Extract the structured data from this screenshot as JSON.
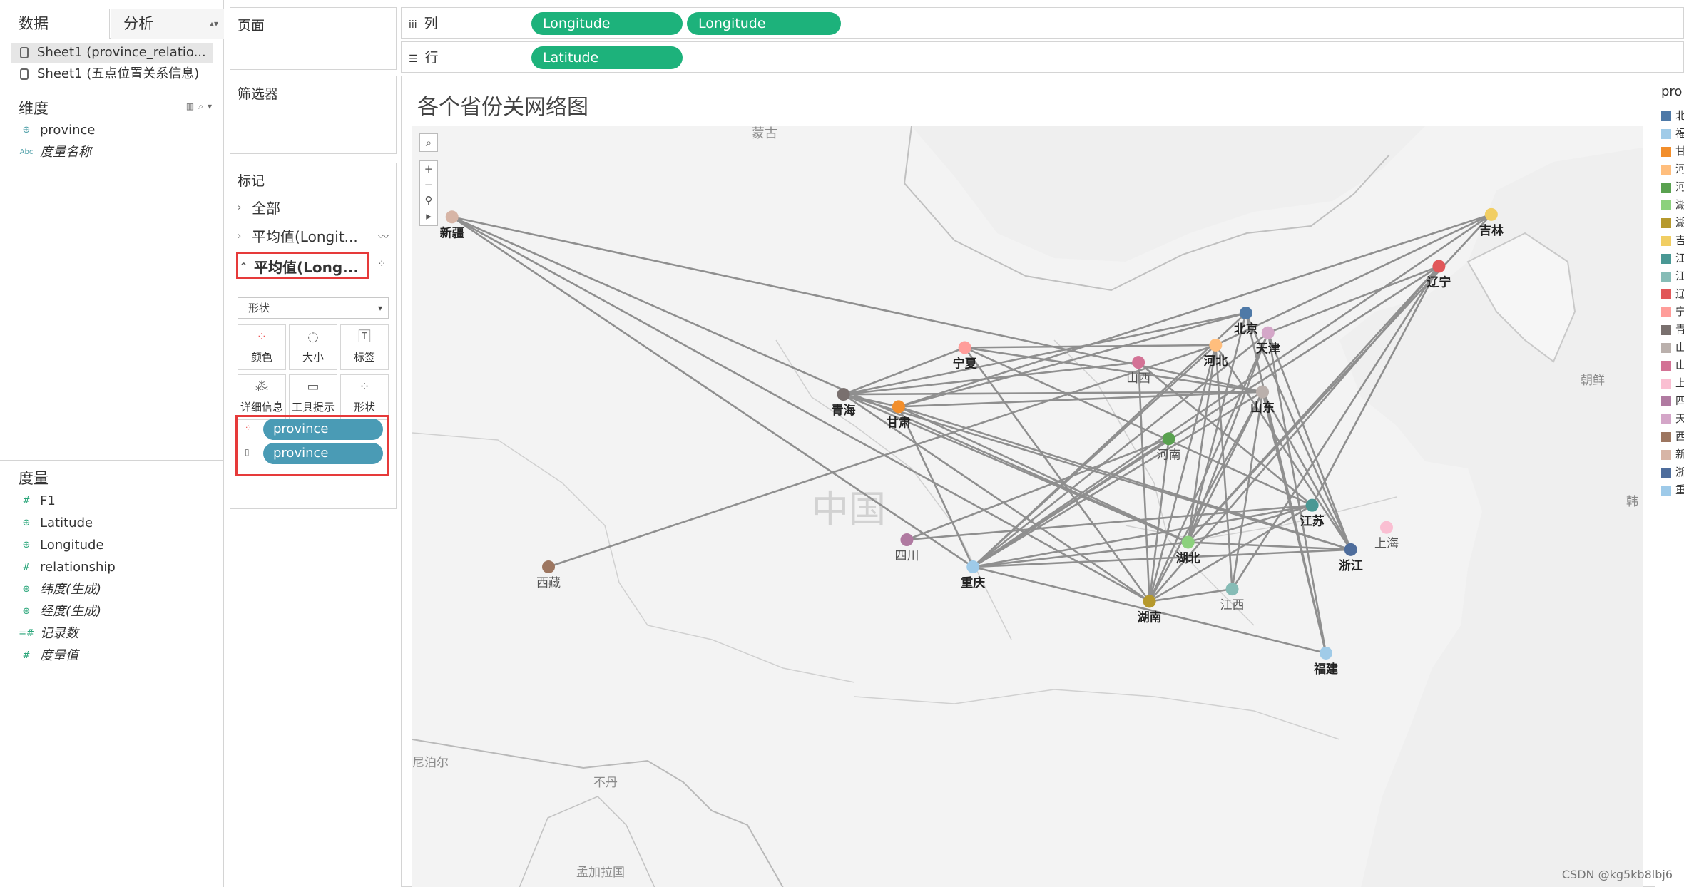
{
  "data_pane": {
    "tabs": [
      {
        "label": "数据"
      },
      {
        "label": "分析"
      }
    ],
    "datasources": [
      {
        "label": "Sheet1 (province_relatio..."
      },
      {
        "label": "Sheet1 (五点位置关系信息)"
      }
    ],
    "dimensions_title": "维度",
    "dimensions": [
      {
        "label": "province",
        "icon": "globe-icon"
      },
      {
        "label": "度量名称",
        "icon": "abc-icon"
      }
    ],
    "measures_title": "度量",
    "measures": [
      {
        "label": "F1",
        "icon": "hash-icon"
      },
      {
        "label": "Latitude",
        "icon": "globe-icon"
      },
      {
        "label": "Longitude",
        "icon": "globe-icon"
      },
      {
        "label": "relationship",
        "icon": "hash-icon"
      },
      {
        "label": "纬度(生成)",
        "icon": "globe-icon"
      },
      {
        "label": "经度(生成)",
        "icon": "globe-icon"
      },
      {
        "label": "记录数",
        "icon": "hash-icon"
      },
      {
        "label": "度量值",
        "icon": "hash-icon"
      }
    ]
  },
  "cards": {
    "pages_title": "页面",
    "filters_title": "筛选器",
    "marks_title": "标记",
    "marks_all": "全部",
    "marks_layer1": "平均值(Longit...",
    "marks_layer2": "平均值(Long...",
    "mark_type": "形状",
    "mark_buttons": [
      "颜色",
      "大小",
      "标签",
      "详细信息",
      "工具提示",
      "形状"
    ],
    "mark_pills": [
      {
        "label": "province"
      },
      {
        "label": "province"
      }
    ]
  },
  "shelves": {
    "columns_label": "列",
    "rows_label": "行",
    "column_pills": [
      "Longitude",
      "Longitude"
    ],
    "row_pills": [
      "Latitude"
    ]
  },
  "view": {
    "title": "各个省份关网络图",
    "basemap_labels": [
      "蒙古",
      "中国",
      "朝鲜",
      "韩",
      "尼泊尔",
      "不丹",
      "孟加拉国"
    ]
  },
  "legend": {
    "title": "pro",
    "items": [
      {
        "label": "北",
        "color": "#4e79a7"
      },
      {
        "label": "福",
        "color": "#a0cbe8"
      },
      {
        "label": "甘",
        "color": "#f28e2b"
      },
      {
        "label": "河",
        "color": "#ffbe7d"
      },
      {
        "label": "河",
        "color": "#59a14f"
      },
      {
        "label": "湖",
        "color": "#8cd17d"
      },
      {
        "label": "湖",
        "color": "#b6992d"
      },
      {
        "label": "吉",
        "color": "#f1ce63"
      },
      {
        "label": "江",
        "color": "#499894"
      },
      {
        "label": "江",
        "color": "#86bcb6"
      },
      {
        "label": "辽",
        "color": "#e15759"
      },
      {
        "label": "宁",
        "color": "#ff9d9a"
      },
      {
        "label": "青",
        "color": "#79706e"
      },
      {
        "label": "山",
        "color": "#bab0ac"
      },
      {
        "label": "山",
        "color": "#d37295"
      },
      {
        "label": "上",
        "color": "#fabfd2"
      },
      {
        "label": "四",
        "color": "#b07aa1"
      },
      {
        "label": "天",
        "color": "#d4a6c8"
      },
      {
        "label": "西",
        "color": "#9d7660"
      },
      {
        "label": "新",
        "color": "#d7b5a6"
      },
      {
        "label": "浙",
        "color": "#4e6d9c"
      },
      {
        "label": "重",
        "color": "#9ecae9"
      }
    ]
  },
  "network": {
    "nodes": [
      {
        "id": "新疆",
        "lon": 87.6,
        "lat": 43.8,
        "color": "#d7b5a6",
        "bold": true
      },
      {
        "id": "吉林",
        "lon": 125.3,
        "lat": 43.9,
        "color": "#f1ce63",
        "bold": true
      },
      {
        "id": "辽宁",
        "lon": 123.4,
        "lat": 41.8,
        "color": "#e15759",
        "bold": true
      },
      {
        "id": "北京",
        "lon": 116.4,
        "lat": 39.9,
        "color": "#4e79a7",
        "bold": true
      },
      {
        "id": "河北",
        "lon": 115.3,
        "lat": 38.6,
        "color": "#ffbe7d",
        "bold": true
      },
      {
        "id": "天津",
        "lon": 117.2,
        "lat": 39.1,
        "color": "#d4a6c8",
        "bold": true
      },
      {
        "id": "甘肃",
        "lon": 103.8,
        "lat": 36.1,
        "color": "#f28e2b",
        "bold": true
      },
      {
        "id": "宁夏",
        "lon": 106.2,
        "lat": 38.5,
        "color": "#ff9d9a",
        "bold": true
      },
      {
        "id": "山西",
        "lon": 112.5,
        "lat": 37.9,
        "color": "#d37295",
        "bold": false
      },
      {
        "id": "青海",
        "lon": 101.8,
        "lat": 36.6,
        "color": "#79706e",
        "bold": true
      },
      {
        "id": "山东",
        "lon": 117.0,
        "lat": 36.7,
        "color": "#bab0ac",
        "bold": true
      },
      {
        "id": "河南",
        "lon": 113.6,
        "lat": 34.8,
        "color": "#59a14f",
        "bold": false
      },
      {
        "id": "江苏",
        "lon": 118.8,
        "lat": 32.1,
        "color": "#499894",
        "bold": true
      },
      {
        "id": "西藏",
        "lon": 91.1,
        "lat": 29.6,
        "color": "#9d7660",
        "bold": false
      },
      {
        "id": "上海",
        "lon": 121.5,
        "lat": 31.2,
        "color": "#fabfd2",
        "bold": false
      },
      {
        "id": "四川",
        "lon": 104.1,
        "lat": 30.7,
        "color": "#b07aa1",
        "bold": false
      },
      {
        "id": "湖北",
        "lon": 114.3,
        "lat": 30.6,
        "color": "#8cd17d",
        "bold": true
      },
      {
        "id": "重庆",
        "lon": 106.5,
        "lat": 29.6,
        "color": "#9ecae9",
        "bold": true
      },
      {
        "id": "浙江",
        "lon": 120.2,
        "lat": 30.3,
        "color": "#4e6d9c",
        "bold": true
      },
      {
        "id": "湖南",
        "lon": 112.9,
        "lat": 28.2,
        "color": "#b6992d",
        "bold": true
      },
      {
        "id": "江西",
        "lon": 115.9,
        "lat": 28.7,
        "color": "#86bcb6",
        "bold": false
      },
      {
        "id": "福建",
        "lon": 119.3,
        "lat": 26.1,
        "color": "#a0cbe8",
        "bold": true
      }
    ],
    "edges": [
      [
        "新疆",
        "重庆"
      ],
      [
        "新疆",
        "湖南"
      ],
      [
        "新疆",
        "湖北"
      ],
      [
        "新疆",
        "山东"
      ],
      [
        "吉林",
        "甘肃"
      ],
      [
        "吉林",
        "河北"
      ],
      [
        "吉林",
        "重庆"
      ],
      [
        "吉林",
        "湖北"
      ],
      [
        "辽宁",
        "天津"
      ],
      [
        "辽宁",
        "重庆"
      ],
      [
        "辽宁",
        "湖南"
      ],
      [
        "辽宁",
        "湖北"
      ],
      [
        "辽宁",
        "江苏"
      ],
      [
        "辽宁",
        "江西"
      ],
      [
        "北京",
        "甘肃"
      ],
      [
        "北京",
        "青海"
      ],
      [
        "北京",
        "重庆"
      ],
      [
        "北京",
        "湖北"
      ],
      [
        "北京",
        "浙江"
      ],
      [
        "北京",
        "福建"
      ],
      [
        "河北",
        "宁夏"
      ],
      [
        "河北",
        "重庆"
      ],
      [
        "河北",
        "湖北"
      ],
      [
        "河北",
        "湖南"
      ],
      [
        "河北",
        "江西"
      ],
      [
        "河北",
        "浙江"
      ],
      [
        "天津",
        "重庆"
      ],
      [
        "天津",
        "湖北"
      ],
      [
        "天津",
        "湖南"
      ],
      [
        "天津",
        "福建"
      ],
      [
        "天津",
        "浙江"
      ],
      [
        "青海",
        "甘肃"
      ],
      [
        "青海",
        "宁夏"
      ],
      [
        "青海",
        "山西"
      ],
      [
        "青海",
        "山东"
      ],
      [
        "青海",
        "湖北"
      ],
      [
        "青海",
        "湖南"
      ],
      [
        "青海",
        "浙江"
      ],
      [
        "甘肃",
        "重庆"
      ],
      [
        "甘肃",
        "湖北"
      ],
      [
        "甘肃",
        "浙江"
      ],
      [
        "甘肃",
        "山东"
      ],
      [
        "宁夏",
        "湖南"
      ],
      [
        "宁夏",
        "江苏"
      ],
      [
        "宁夏",
        "山东"
      ],
      [
        "西藏",
        "河北"
      ],
      [
        "四川",
        "江苏"
      ],
      [
        "四川",
        "河南"
      ],
      [
        "山东",
        "重庆"
      ],
      [
        "山东",
        "湖北"
      ],
      [
        "山东",
        "湖南"
      ],
      [
        "山东",
        "浙江"
      ],
      [
        "山东",
        "江西"
      ],
      [
        "山东",
        "福建"
      ],
      [
        "江苏",
        "重庆"
      ],
      [
        "江苏",
        "湖北"
      ],
      [
        "江苏",
        "湖南"
      ],
      [
        "江苏",
        "山西"
      ],
      [
        "河南",
        "重庆"
      ],
      [
        "河南",
        "湖南"
      ],
      [
        "湖北",
        "浙江"
      ],
      [
        "重庆",
        "浙江"
      ],
      [
        "重庆",
        "湖北"
      ],
      [
        "湖南",
        "江西"
      ],
      [
        "山西",
        "湖南"
      ],
      [
        "福建",
        "重庆"
      ]
    ]
  },
  "watermark": "CSDN @kg5kb8lbj6"
}
